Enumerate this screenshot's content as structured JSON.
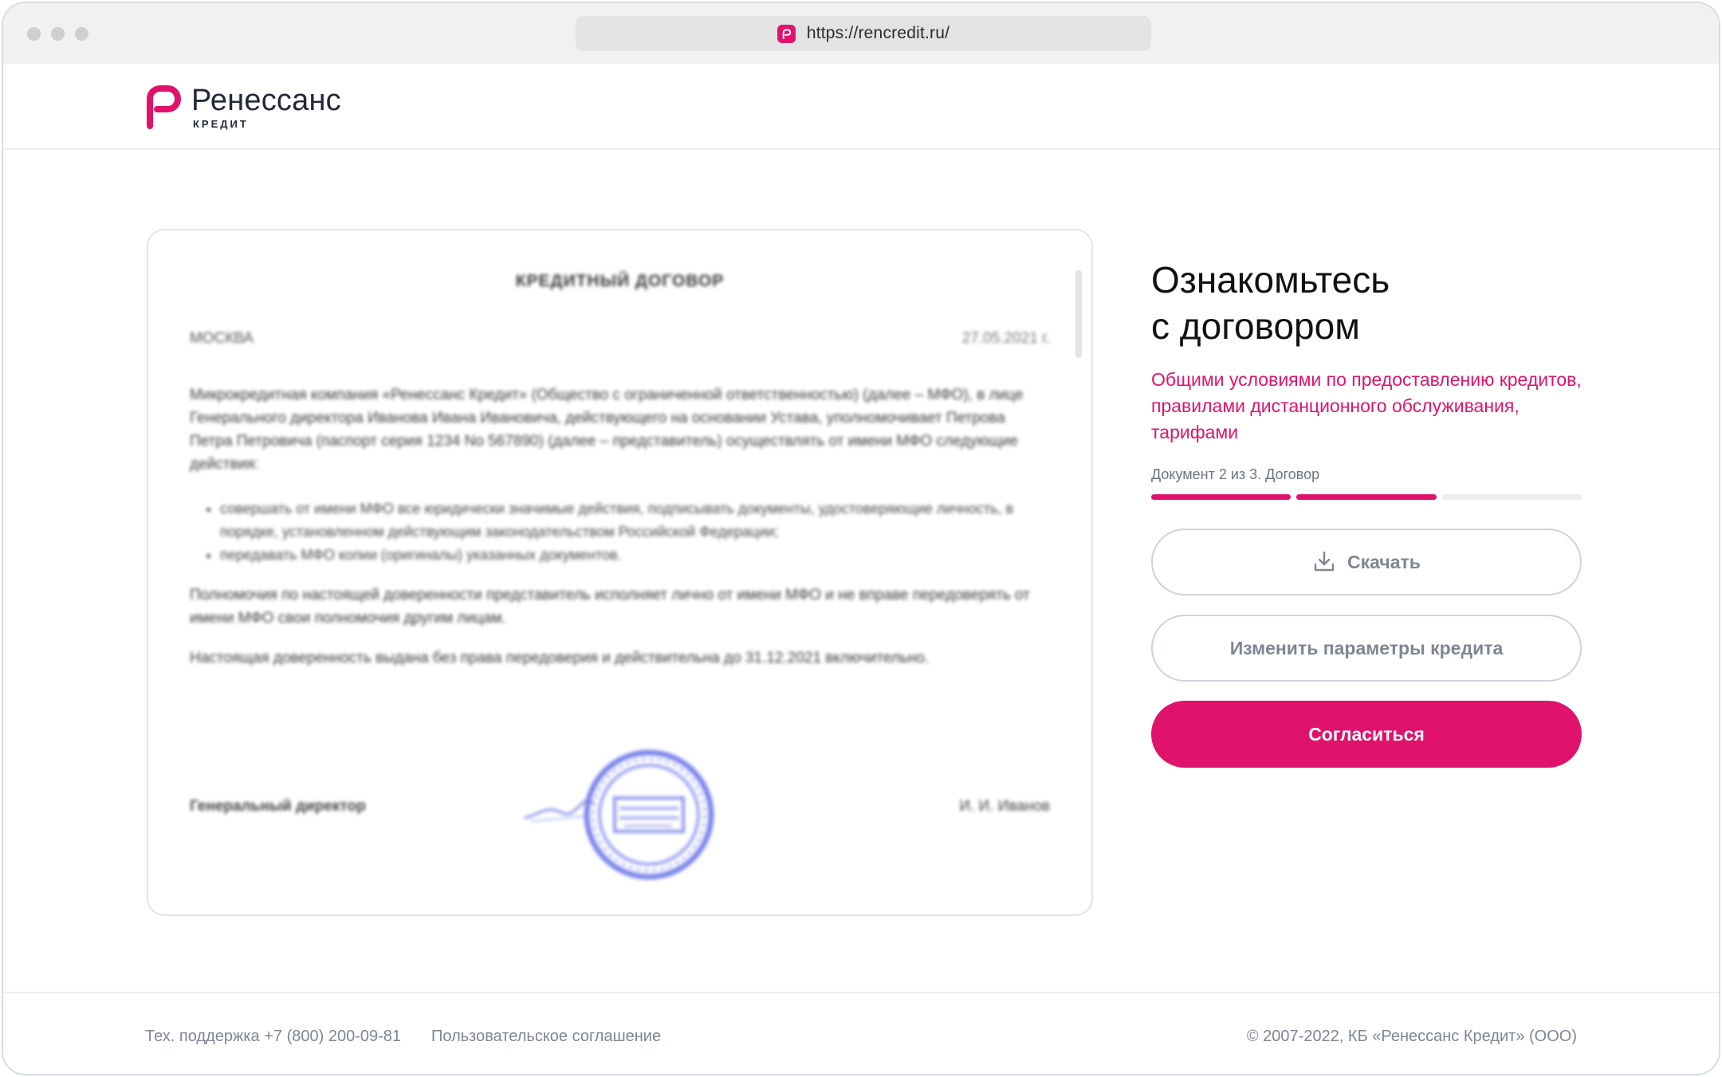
{
  "browser": {
    "url": "https://rencredit.ru/"
  },
  "brand": {
    "name": "Ренессанс",
    "sub": "КРЕДИТ",
    "accent_color": "#e0136c"
  },
  "document": {
    "title": "КРЕДИТНЫЙ ДОГОВОР",
    "city": "МОСКВА",
    "date": "27.05.2021 г.",
    "paragraph_1": "Микрокредитная компания «Ренессанс Кредит» (Общество с ограниченной ответственностью) (далее – МФО), в лице Генерального директора Иванова Ивана Ивановича, действующего на основании Устава, уполномочивает Петрова Петра Петровича (паспорт серия 1234 No 567890) (далее – представитель) осуществлять от имени МФО следующие действия:",
    "list": [
      "совершать от имени МФО все юридически значимые действия, подписывать документы, удостоверяющие личность, в порядке, установленном действующим законодательством Российской Федерации;",
      "передавать МФО копии (оригиналы) указанных документов."
    ],
    "paragraph_2": "Полномочия по настоящей доверенности представитель исполняет лично от имени МФО и не вправе передоверять от имени МФО свои полномочия другим лицам.",
    "paragraph_3": "Настоящая доверенность выдана без права передоверия и действительна до 31.12.2021 включительно.",
    "signer_title": "Генеральный директор",
    "signer_name": "И. И. Иванов"
  },
  "side": {
    "title": "Ознакомьтесь\nс договором",
    "links": {
      "general_terms": "Общими условиями по предоставлению кредитов",
      "sep1": ", ",
      "remote_rules": "правилами дистанционного обслуживания",
      "sep2": ", ",
      "tariffs": "тарифами"
    },
    "progress_label": "Документ 2 из 3. Договор",
    "progress": {
      "current": 2,
      "total": 3
    },
    "buttons": {
      "download": "Скачать",
      "change_params": "Изменить параметры кредита",
      "agree": "Согласиться"
    }
  },
  "footer": {
    "support": "Тех. поддержка +7 (800) 200-09-81",
    "agreement": "Пользовательское соглашение",
    "copyright": "© 2007-2022, КБ «Ренессанс Кредит» (ООО)"
  }
}
